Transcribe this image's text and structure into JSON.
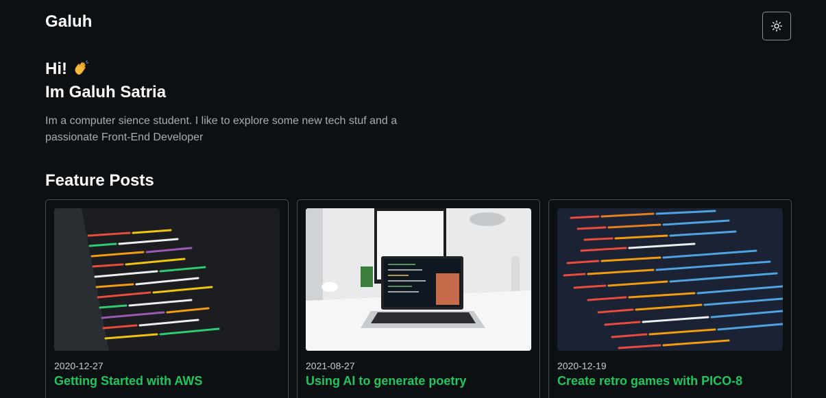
{
  "header": {
    "site_title": "Galuh",
    "theme_toggle_icon": "sun-icon"
  },
  "hero": {
    "greeting": "Hi!",
    "wave_emoji": "👋",
    "name_line": "Im Galuh Satria",
    "bio": "Im a computer sience student. I like to explore some new tech stuf and a passionate Front-End Developer"
  },
  "featured": {
    "title": "Feature Posts",
    "posts": [
      {
        "date": "2020-12-27",
        "title": "Getting Started with AWS",
        "thumbnail": "code-monitor-image"
      },
      {
        "date": "2021-08-27",
        "title": "Using AI to generate poetry",
        "thumbnail": "laptop-desk-image"
      },
      {
        "date": "2020-12-19",
        "title": "Create retro games with PICO-8",
        "thumbnail": "html-code-screen-image"
      }
    ]
  },
  "colors": {
    "background": "#0d1013",
    "accent": "#22c55e",
    "muted_text": "#a8adb3",
    "border": "#4a4f55"
  }
}
